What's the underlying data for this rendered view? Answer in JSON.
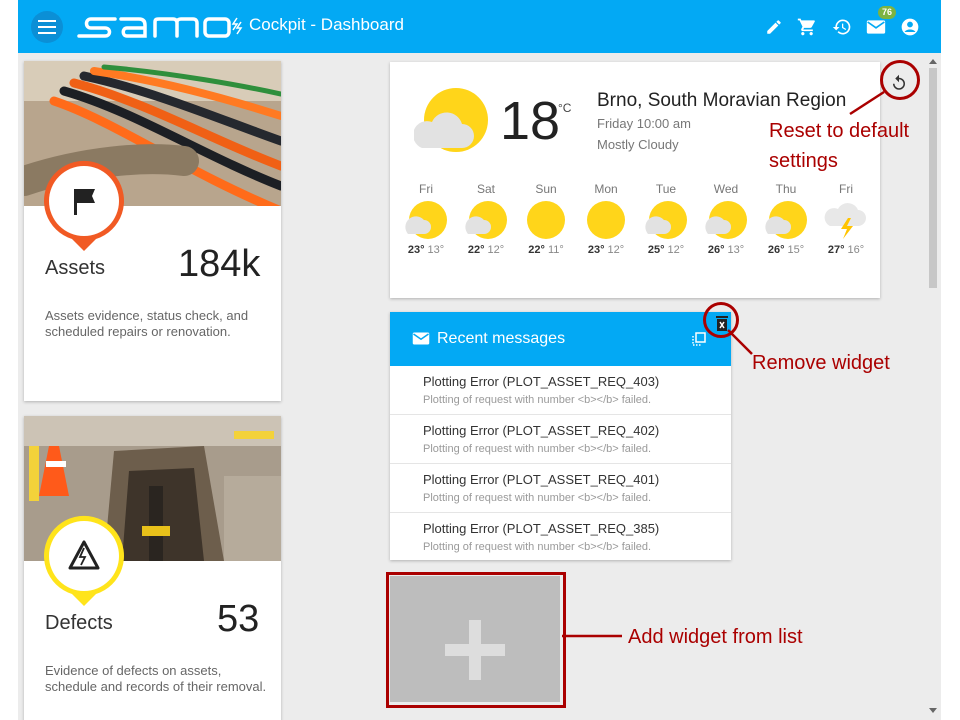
{
  "header": {
    "logo_text": "samo",
    "title": "Cockpit - Dashboard",
    "mail_badge": "76",
    "icons": [
      "menu-icon",
      "pencil-icon",
      "cart-icon",
      "history-icon",
      "mail-icon",
      "account-icon"
    ],
    "color": "#03a9f4"
  },
  "cards": [
    {
      "label": "Assets",
      "value": "184k",
      "description": "Assets evidence, status check, and scheduled repairs or renovation.",
      "marker_color": "#f15a24",
      "icon": "flag-icon"
    },
    {
      "label": "Defects",
      "value": "53",
      "description": "Evidence of defects on assets, schedule and records of their removal.",
      "marker_color": "#ffe41b",
      "icon": "warning-icon"
    }
  ],
  "weather": {
    "temperature": "18",
    "unit": "°C",
    "location": "Brno, South Moravian Region",
    "datetime": "Friday 10:00 am",
    "condition": "Mostly Cloudy",
    "forecast": [
      {
        "day": "Fri",
        "high": "23°",
        "low": "13°",
        "icon": "partly-cloudy-icon"
      },
      {
        "day": "Sat",
        "high": "22°",
        "low": "12°",
        "icon": "partly-cloudy-icon"
      },
      {
        "day": "Sun",
        "high": "22°",
        "low": "11°",
        "icon": "sunny-icon"
      },
      {
        "day": "Mon",
        "high": "23°",
        "low": "12°",
        "icon": "sunny-icon"
      },
      {
        "day": "Tue",
        "high": "25°",
        "low": "12°",
        "icon": "partly-cloudy-icon"
      },
      {
        "day": "Wed",
        "high": "26°",
        "low": "13°",
        "icon": "partly-cloudy-icon"
      },
      {
        "day": "Thu",
        "high": "26°",
        "low": "15°",
        "icon": "partly-cloudy-icon"
      },
      {
        "day": "Fri",
        "high": "27°",
        "low": "16°",
        "icon": "thunderstorm-icon"
      }
    ]
  },
  "messages": {
    "title": "Recent messages",
    "items": [
      {
        "title": "Plotting Error (PLOT_ASSET_REQ_403)",
        "subtitle": "Plotting of request with number <b></b> failed."
      },
      {
        "title": "Plotting Error (PLOT_ASSET_REQ_402)",
        "subtitle": "Plotting of request with number <b></b> failed."
      },
      {
        "title": "Plotting Error (PLOT_ASSET_REQ_401)",
        "subtitle": "Plotting of request with number <b></b> failed."
      },
      {
        "title": "Plotting Error (PLOT_ASSET_REQ_385)",
        "subtitle": "Plotting of request with number <b></b> failed."
      }
    ]
  },
  "annotations": {
    "reset_line1": "Reset to default",
    "reset_line2": "settings",
    "remove": "Remove widget",
    "add": "Add widget from list",
    "color": "#aa0000"
  }
}
